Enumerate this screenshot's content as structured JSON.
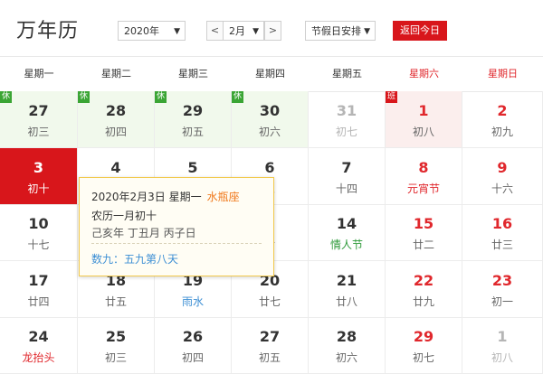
{
  "header": {
    "title": "万年历",
    "year": "2020年",
    "month": "2月",
    "prev": "<",
    "next": ">",
    "holiday_select": "节假日安排",
    "today_button": "返回今日"
  },
  "weekdays": [
    "星期一",
    "星期二",
    "星期三",
    "星期四",
    "星期五",
    "星期六",
    "星期日"
  ],
  "weeks": [
    [
      {
        "day": "27",
        "lunar": "初三",
        "badge": "休"
      },
      {
        "day": "28",
        "lunar": "初四",
        "badge": "休"
      },
      {
        "day": "29",
        "lunar": "初五",
        "badge": "休"
      },
      {
        "day": "30",
        "lunar": "初六",
        "badge": "休"
      },
      {
        "day": "31",
        "lunar": "初七",
        "other": true
      },
      {
        "day": "1",
        "lunar": "初八",
        "badge": "班",
        "work": true
      },
      {
        "day": "2",
        "lunar": "初九"
      }
    ],
    [
      {
        "day": "3",
        "lunar": "初十",
        "today": true
      },
      {
        "day": "4",
        "lunar": ""
      },
      {
        "day": "5",
        "lunar": ""
      },
      {
        "day": "6",
        "lunar": "三"
      },
      {
        "day": "7",
        "lunar": "十四"
      },
      {
        "day": "8",
        "lunar": "元宵节",
        "fest": "red"
      },
      {
        "day": "9",
        "lunar": "十六"
      }
    ],
    [
      {
        "day": "10",
        "lunar": "十七"
      },
      {
        "day": "11",
        "lunar": ""
      },
      {
        "day": "12",
        "lunar": ""
      },
      {
        "day": "3",
        "lunar": "廿"
      },
      {
        "day": "14",
        "lunar": "情人节",
        "fest": "green"
      },
      {
        "day": "15",
        "lunar": "廿二"
      },
      {
        "day": "16",
        "lunar": "廿三"
      }
    ],
    [
      {
        "day": "17",
        "lunar": "廿四"
      },
      {
        "day": "18",
        "lunar": "廿五"
      },
      {
        "day": "19",
        "lunar": "雨水",
        "fest": "term"
      },
      {
        "day": "20",
        "lunar": "廿七"
      },
      {
        "day": "21",
        "lunar": "廿八"
      },
      {
        "day": "22",
        "lunar": "廿九"
      },
      {
        "day": "23",
        "lunar": "初一"
      }
    ],
    [
      {
        "day": "24",
        "lunar": "龙抬头",
        "fest": "red"
      },
      {
        "day": "25",
        "lunar": "初三"
      },
      {
        "day": "26",
        "lunar": "初四"
      },
      {
        "day": "27",
        "lunar": "初五"
      },
      {
        "day": "28",
        "lunar": "初六"
      },
      {
        "day": "29",
        "lunar": "初七"
      },
      {
        "day": "1",
        "lunar": "初八",
        "other": true
      }
    ]
  ],
  "popup": {
    "date_line": "2020年2月3日 星期一",
    "zodiac": "水瓶座",
    "lunar_line": "农历一月初十",
    "ganzhi_line": "己亥年 丁丑月 丙子日",
    "shujiu_line": "数九：五九第八天"
  }
}
